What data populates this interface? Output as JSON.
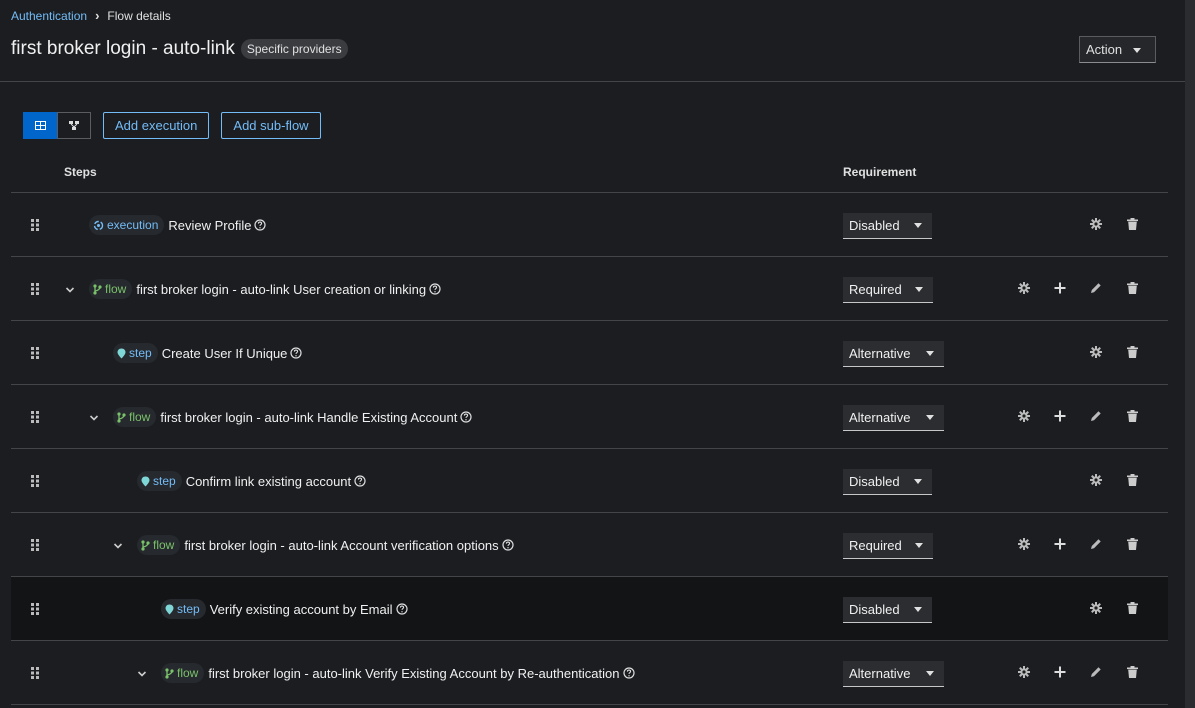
{
  "breadcrumb": {
    "parent": "Authentication",
    "current": "Flow details"
  },
  "page": {
    "title": "first broker login - auto-link",
    "badge": "Specific providers",
    "action_label": "Action"
  },
  "toolbar": {
    "add_execution": "Add execution",
    "add_subflow": "Add sub-flow",
    "view_table_icon": "table-icon",
    "view_diagram_icon": "diagram-icon"
  },
  "table": {
    "headers": {
      "steps": "Steps",
      "requirement": "Requirement"
    },
    "rows": [
      {
        "tag": "execution",
        "label": "Review Profile",
        "requirement": "Disabled"
      },
      {
        "tag": "flow",
        "label": "first broker login - auto-link User creation or linking",
        "requirement": "Required"
      },
      {
        "tag": "step",
        "label": "Create User If Unique",
        "requirement": "Alternative"
      },
      {
        "tag": "flow",
        "label": "first broker login - auto-link Handle Existing Account",
        "requirement": "Alternative"
      },
      {
        "tag": "step",
        "label": "Confirm link existing account",
        "requirement": "Disabled"
      },
      {
        "tag": "flow",
        "label": "first broker login - auto-link Account verification options",
        "requirement": "Required"
      },
      {
        "tag": "step",
        "label": "Verify existing account by Email",
        "requirement": "Disabled"
      },
      {
        "tag": "flow",
        "label": "first broker login - auto-link Verify Existing Account by Re-authentication",
        "requirement": "Alternative"
      }
    ]
  },
  "colors": {
    "accent": "#73bcf7",
    "primary": "#0066cc",
    "flow_tag": "#7ac16b",
    "background": "#1b1d21"
  }
}
